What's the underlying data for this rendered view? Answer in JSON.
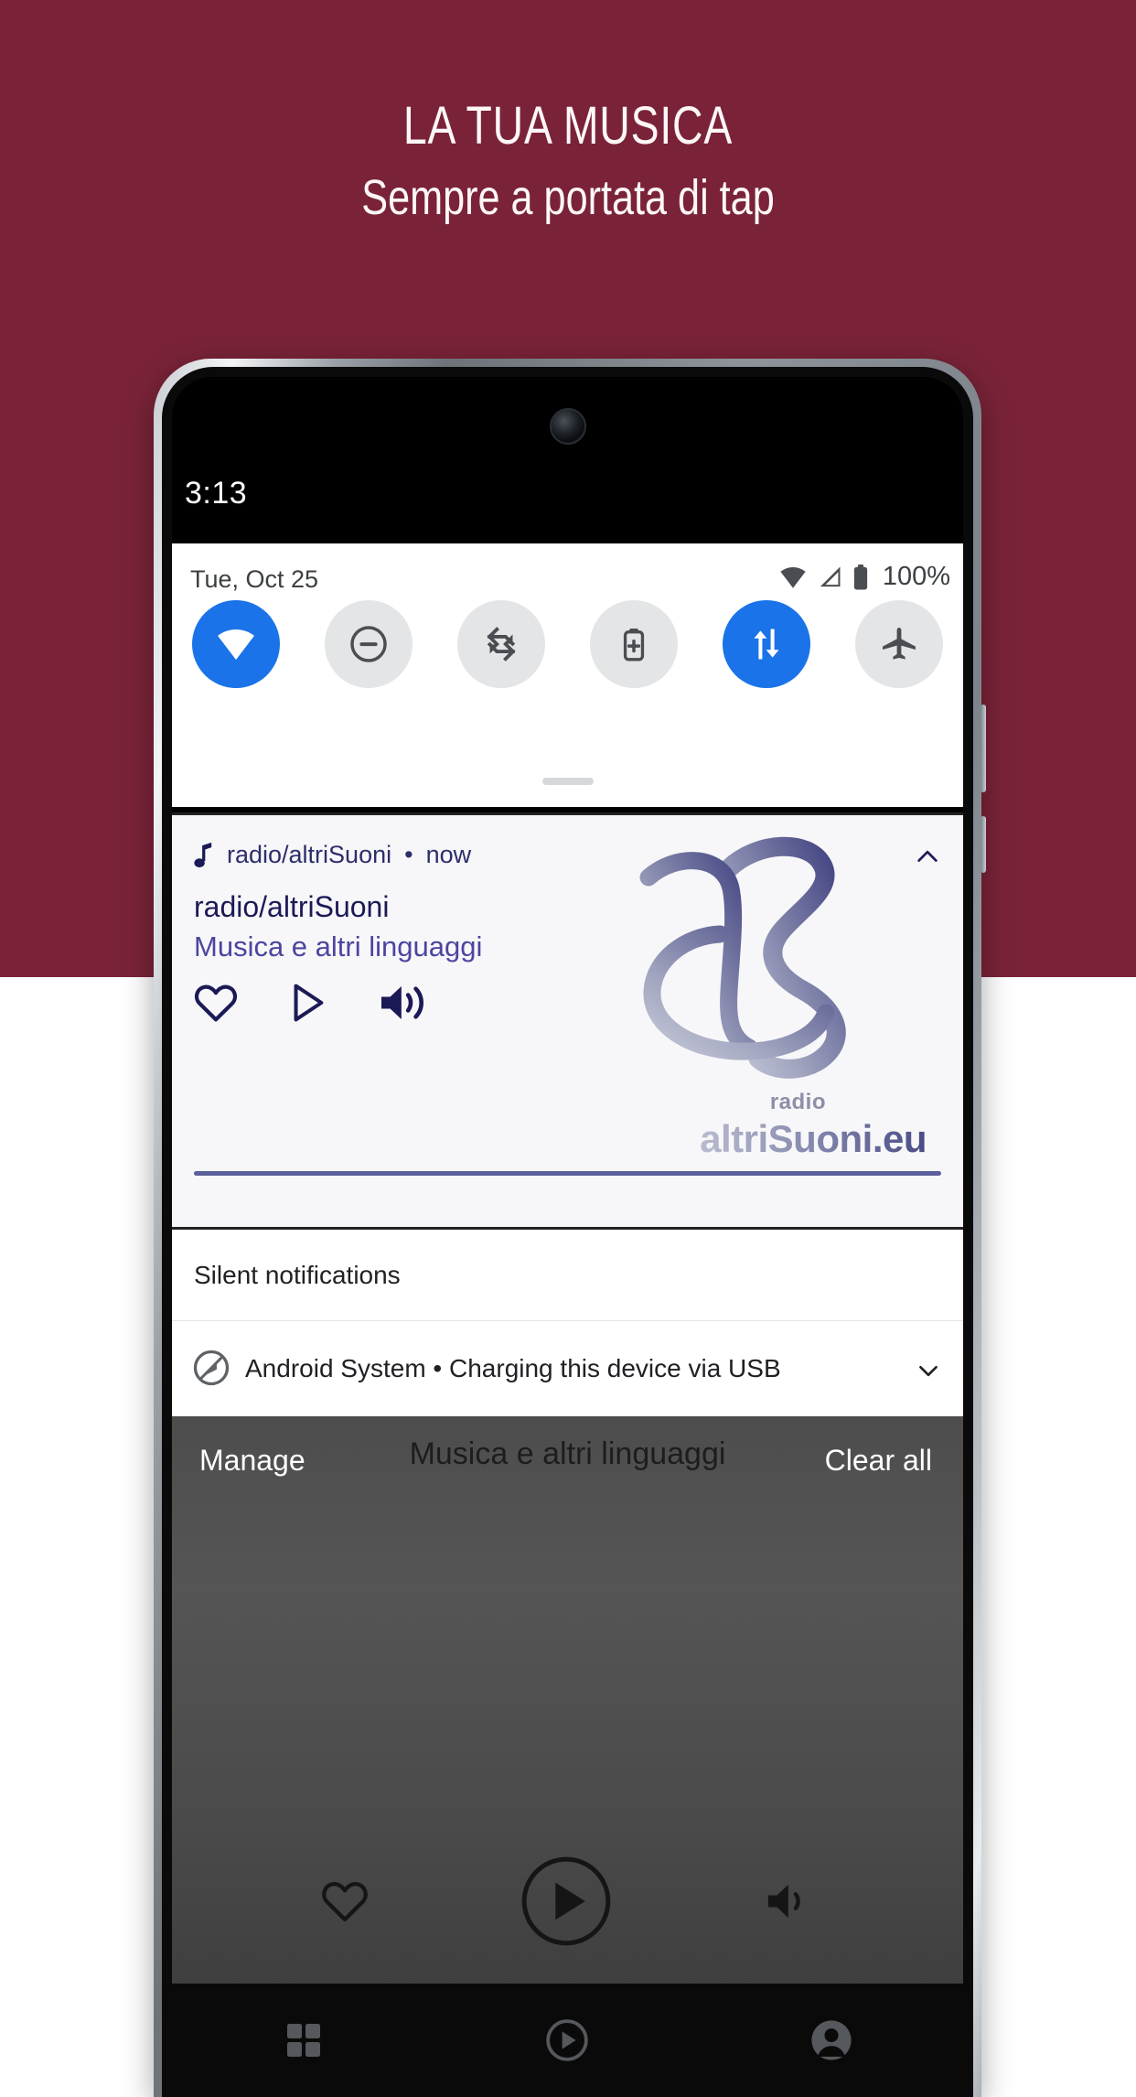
{
  "hero": {
    "title": "LA TUA MUSICA",
    "subtitle": "Sempre a portata di tap",
    "bg_color": "#7a2338",
    "text_color": "#fdf7f8"
  },
  "phone": {
    "status_bar": {
      "time": "3:13"
    },
    "quick_settings": {
      "date": "Tue, Oct 25",
      "battery_percent": "100%",
      "status_icons": [
        "wifi-icon",
        "signal-icon",
        "battery-icon"
      ],
      "tiles": [
        {
          "name": "wifi-tile",
          "icon": "wifi-icon",
          "active": true,
          "active_color": "#1a73e8"
        },
        {
          "name": "dnd-tile",
          "icon": "do-not-disturb-icon",
          "active": false,
          "active_color": "#e3e5e7"
        },
        {
          "name": "auto-rotate-tile",
          "icon": "auto-rotate-icon",
          "active": false,
          "active_color": "#e3e5e7"
        },
        {
          "name": "battery-saver-tile",
          "icon": "battery-saver-icon",
          "active": false,
          "active_color": "#e3e5e7"
        },
        {
          "name": "mobile-data-tile",
          "icon": "mobile-data-icon",
          "active": true,
          "active_color": "#1a73e8"
        },
        {
          "name": "airplane-mode-tile",
          "icon": "airplane-icon",
          "active": false,
          "active_color": "#e3e5e7"
        }
      ]
    },
    "media_notification": {
      "app_name": "radio/altriSuoni",
      "separator": "•",
      "time": "now",
      "title": "radio/altriSuoni",
      "subtitle": "Musica e altri linguaggi",
      "accent_color": "#1b1a57",
      "subtitle_color": "#4b45a0",
      "actions": [
        {
          "name": "favorite-button",
          "icon": "heart-icon"
        },
        {
          "name": "play-button",
          "icon": "play-icon"
        },
        {
          "name": "volume-button",
          "icon": "volume-icon"
        }
      ],
      "collapse_icon": "chevron-up-icon",
      "logo": {
        "radio_label": "radio",
        "wordmark": "altriSuoni.eu"
      }
    },
    "silent_section": {
      "header": "Silent notifications",
      "items": [
        {
          "icon": "android-system-icon",
          "text": "Android System • Charging this device via USB",
          "expand_icon": "chevron-down-icon"
        }
      ]
    },
    "shade_footer": {
      "manage_label": "Manage",
      "clear_all_label": "Clear all"
    },
    "app_behind": {
      "ghost_title": "Musica e altri linguaggi",
      "controls": [
        {
          "name": "app-favorite-button",
          "icon": "heart-icon"
        },
        {
          "name": "app-play-button",
          "icon": "play-circle-icon"
        },
        {
          "name": "app-volume-button",
          "icon": "volume-icon"
        }
      ]
    },
    "nav_bar": [
      {
        "name": "nav-grid",
        "icon": "grid-icon"
      },
      {
        "name": "nav-player",
        "icon": "play-circle-icon"
      },
      {
        "name": "nav-account",
        "icon": "account-icon"
      }
    ]
  }
}
